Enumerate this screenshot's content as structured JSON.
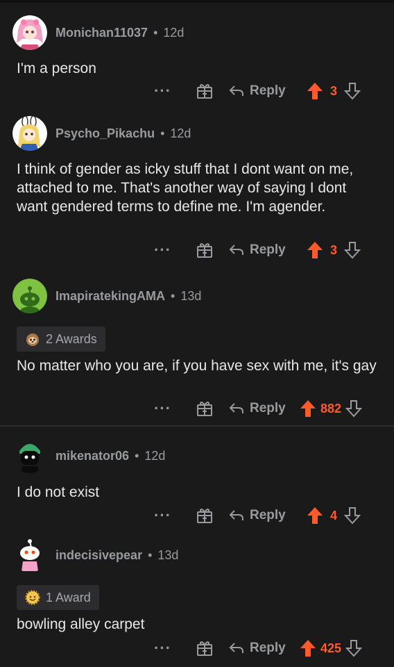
{
  "colors": {
    "background": "#1a1a1b",
    "accent": "#ff5a2b",
    "muted": "#9a9b9e"
  },
  "comments": [
    {
      "username": "Monichan11037",
      "age": "12d",
      "text": "I'm a person",
      "reply_label": "Reply",
      "score": "3",
      "avatar_icon": "pink-haired-avatar"
    },
    {
      "username": "Psycho_Pikachu",
      "age": "12d",
      "text": "I think of gender as icky stuff that I dont want on me, attached to me. That's another way of saying I dont want gendered terms to define me. I'm agender.",
      "reply_label": "Reply",
      "score": "3",
      "avatar_icon": "bunny-ears-avatar"
    },
    {
      "username": "ImapiratekingAMA",
      "age": "13d",
      "awards_label": "2 Awards",
      "awards_icon": "sloth-award-icon",
      "text": "No matter who you are, if you have sex with me, it's gay",
      "reply_label": "Reply",
      "score": "882",
      "avatar_icon": "green-snoo-avatar"
    },
    {
      "username": "mikenator06",
      "age": "12d",
      "text": "I do not exist",
      "reply_label": "Reply",
      "score": "4",
      "avatar_icon": "dark-snoo-avatar"
    },
    {
      "username": "indecisivepear",
      "age": "13d",
      "awards_label": "1 Award",
      "awards_icon": "wholesome-award-icon",
      "text": "bowling alley carpet",
      "reply_label": "Reply",
      "score": "425",
      "avatar_icon": "white-snoo-avatar"
    }
  ],
  "separator": "•",
  "more_label": "···"
}
